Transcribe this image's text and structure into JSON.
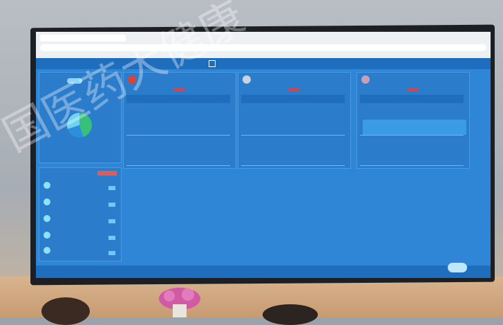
{
  "app": {
    "window_title": "",
    "header_title": "",
    "address_text": ""
  },
  "left_panel": {
    "button_label": "",
    "tab_label": ""
  },
  "cards": [
    {
      "name": "",
      "status": ""
    },
    {
      "name": "",
      "status": ""
    },
    {
      "name": "",
      "status": ""
    }
  ],
  "list": {
    "items": [
      {
        "text": ""
      },
      {
        "text": ""
      },
      {
        "text": ""
      },
      {
        "text": ""
      },
      {
        "text": ""
      }
    ]
  },
  "watermark": {
    "text": "国医药大健康"
  },
  "colors": {
    "screen_bg": "#2f86d6",
    "panel_bg": "#2b7ccb",
    "header_bg": "#1f6dbd",
    "accent_red": "#e04040"
  }
}
